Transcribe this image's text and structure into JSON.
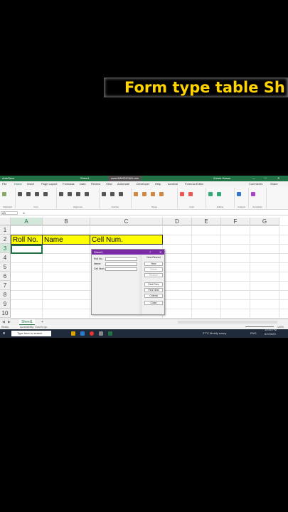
{
  "overlay": {
    "title": "Form type table Sh"
  },
  "window": {
    "left_label": "AutoSave",
    "filename": "Sheet1",
    "watermark": "www.BANDICAM.com",
    "user": "Zoheb Hasan",
    "accent": "#217346"
  },
  "menu": [
    "File",
    "Home",
    "Insert",
    "Page Layout",
    "Formulas",
    "Data",
    "Review",
    "View",
    "Automate",
    "Developer",
    "Help",
    "Acrobat",
    "Formula Editor"
  ],
  "menu_right": [
    "Comments",
    "Share"
  ],
  "ribbon_groups": [
    "Clipboard",
    "Font",
    "Alignment",
    "Number",
    "Styles",
    "Cells",
    "Editing",
    "Analysis",
    "Sensitivity"
  ],
  "formula": {
    "namebox": "A3",
    "fx": "fx"
  },
  "columns": [
    "A",
    "B",
    "C",
    "D",
    "E",
    "F",
    "G"
  ],
  "rows": [
    "1",
    "2",
    "3",
    "4",
    "5",
    "6",
    "7",
    "8",
    "9",
    "10"
  ],
  "headers": {
    "a2": "Roll No.",
    "b2": "Name",
    "c2": "Cell Num."
  },
  "sheet": {
    "tab": "Sheet1",
    "add": "+"
  },
  "status": {
    "ready": "Ready",
    "accessibility": "Accessibility: Good to go",
    "zoom": "100%"
  },
  "taskbar": {
    "search": "Type here to search",
    "weather": "27°C  Mostly sunny",
    "lang": "ENG",
    "time": "10:50 PM",
    "date": "6/7/2023"
  },
  "form": {
    "title": "Sheet1",
    "close": "✕",
    "help": "?",
    "record": "New Record",
    "fields": [
      "Roll No.:",
      "Name:",
      "Cell Num.:"
    ],
    "buttons": [
      "New",
      "Delete",
      "Restore",
      "Find Prev",
      "Find Next",
      "Criteria",
      "Close"
    ],
    "disabled": [
      false,
      true,
      true,
      false,
      false,
      false,
      false
    ]
  }
}
